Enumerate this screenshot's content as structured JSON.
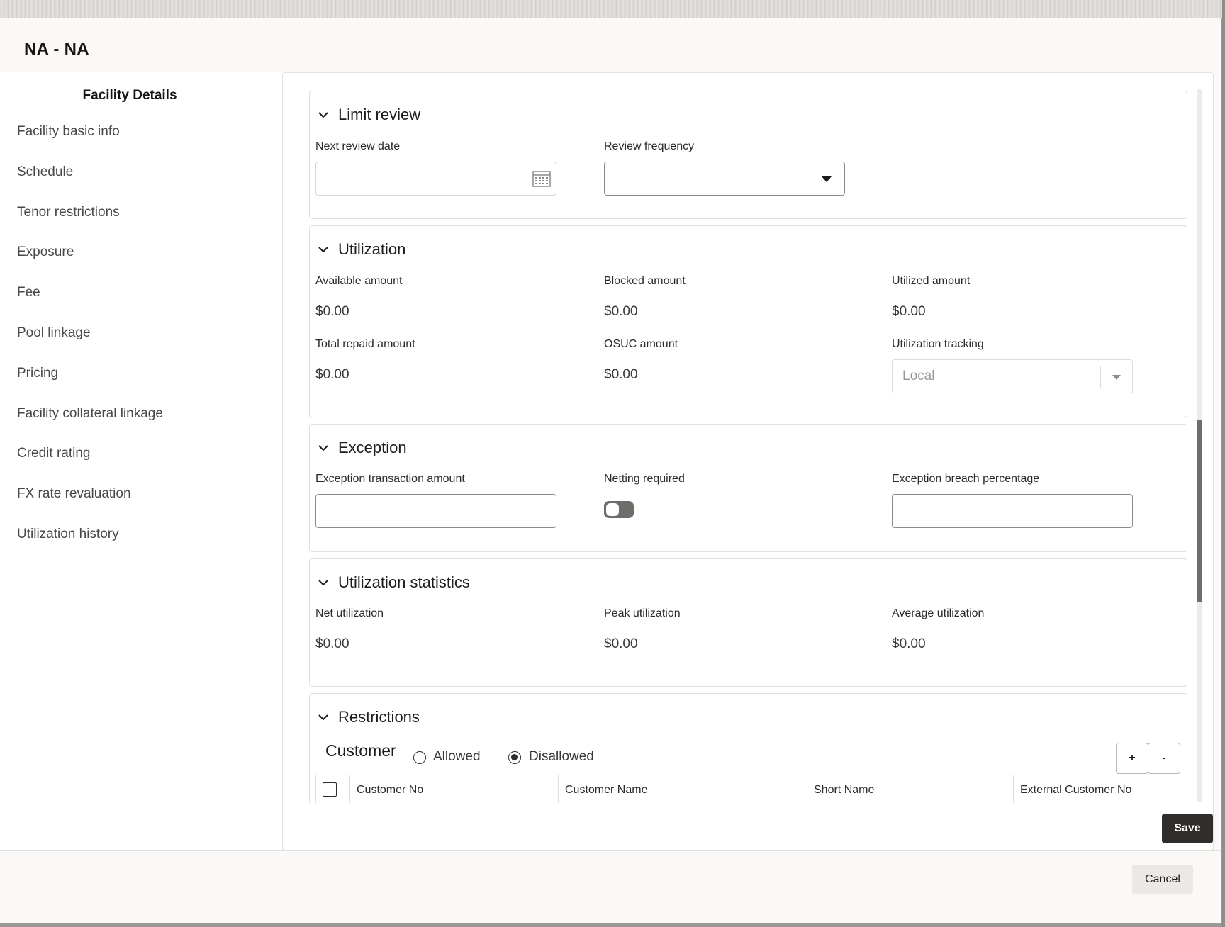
{
  "dialog": {
    "title": "NA - NA"
  },
  "sidebar": {
    "heading": "Facility Details",
    "items": [
      {
        "label": "Facility basic info"
      },
      {
        "label": "Schedule"
      },
      {
        "label": "Tenor restrictions"
      },
      {
        "label": "Exposure"
      },
      {
        "label": "Fee"
      },
      {
        "label": "Pool linkage"
      },
      {
        "label": "Pricing"
      },
      {
        "label": "Facility collateral linkage"
      },
      {
        "label": "Credit rating"
      },
      {
        "label": "FX rate revaluation"
      },
      {
        "label": "Utilization history"
      }
    ]
  },
  "limit_review": {
    "title": "Limit review",
    "next_review_date_label": "Next review date",
    "next_review_date_value": "",
    "review_frequency_label": "Review frequency",
    "review_frequency_value": ""
  },
  "utilization": {
    "title": "Utilization",
    "available_label": "Available amount",
    "available_value": "$0.00",
    "blocked_label": "Blocked amount",
    "blocked_value": "$0.00",
    "utilized_label": "Utilized amount",
    "utilized_value": "$0.00",
    "total_repaid_label": "Total repaid amount",
    "total_repaid_value": "$0.00",
    "osuc_label": "OSUC amount",
    "osuc_value": "$0.00",
    "tracking_label": "Utilization tracking",
    "tracking_value": "Local"
  },
  "exception": {
    "title": "Exception",
    "txn_amount_label": "Exception transaction amount",
    "txn_amount_value": "",
    "netting_label": "Netting required",
    "netting_on": false,
    "breach_label": "Exception breach percentage",
    "breach_value": ""
  },
  "utilization_statistics": {
    "title": "Utilization statistics",
    "net_label": "Net utilization",
    "net_value": "$0.00",
    "peak_label": "Peak utilization",
    "peak_value": "$0.00",
    "average_label": "Average utilization",
    "average_value": "$0.00"
  },
  "restrictions": {
    "title": "Restrictions",
    "customer_label": "Customer",
    "allowed_label": "Allowed",
    "disallowed_label": "Disallowed",
    "selected": "Disallowed",
    "add_label": "+",
    "remove_label": "-",
    "columns": [
      "Customer No",
      "Customer Name",
      "Short Name",
      "External Customer No"
    ]
  },
  "actions": {
    "save_label": "Save",
    "cancel_label": "Cancel"
  },
  "icons": {
    "calendar": "calendar-icon",
    "chevron": "chevron-down-icon",
    "dropdown": "dropdown-arrow-icon"
  }
}
